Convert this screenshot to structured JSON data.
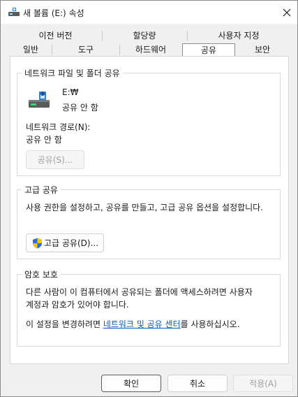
{
  "window": {
    "title": "새 볼륨 (E:) 속성",
    "close_icon": "close-icon",
    "title_icon": "drive-icon"
  },
  "tabs": {
    "row1": [
      "이전 버전",
      "할당량",
      "사용자 지정"
    ],
    "row2": [
      "일반",
      "도구",
      "하드웨어",
      "공유",
      "보안"
    ],
    "selected": "공유"
  },
  "network_share": {
    "group_title": "네트워크 파일 및 폴더 공유",
    "drive_path": "E:₩",
    "share_status": "공유 안 함",
    "network_path_label": "네트워크 경로(N):",
    "network_path_value": "공유 안 함",
    "share_button": "공유(S)..."
  },
  "advanced_share": {
    "group_title": "고급 공유",
    "description": "사용 권한을 설정하고, 공유를 만들고, 고급 공유 옵션을 설정합니다.",
    "button": "고급 공유(D)..."
  },
  "password": {
    "group_title": "암호 보호",
    "line1": "다른 사람이 이 컴퓨터에서 공유되는 폴더에 액세스하려면 사용자",
    "line2": "계정과 암호가 있어야 합니다.",
    "line3_pre": "이 설정을 변경하려면 ",
    "line3_link": "네트워크 및 공유 센터",
    "line3_post": "를 사용하십시오."
  },
  "buttons": {
    "ok": "확인",
    "cancel": "취소",
    "apply": "적용(A)"
  },
  "colors": {
    "link": "#0a5bb5",
    "window_bg": "#f0f0f0",
    "panel_bg": "#ffffff",
    "shield_blue": "#2a6fd6",
    "shield_yellow": "#f2c500"
  }
}
